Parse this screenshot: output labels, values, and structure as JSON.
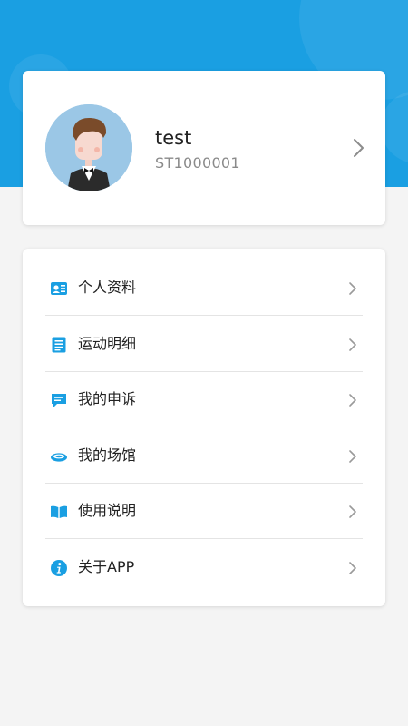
{
  "theme": {
    "accent": "#1a9fe2",
    "background": "#f4f4f4"
  },
  "profile": {
    "avatar_icon": "avatar-icon",
    "name": "test",
    "id": "ST1000001"
  },
  "menu": {
    "items": [
      {
        "label": "个人资料",
        "icon": "id-card-icon"
      },
      {
        "label": "运动明细",
        "icon": "document-list-icon"
      },
      {
        "label": "我的申诉",
        "icon": "chat-bubble-icon"
      },
      {
        "label": "我的场馆",
        "icon": "venue-icon"
      },
      {
        "label": "使用说明",
        "icon": "open-book-icon"
      },
      {
        "label": "关于APP",
        "icon": "info-icon"
      }
    ]
  }
}
